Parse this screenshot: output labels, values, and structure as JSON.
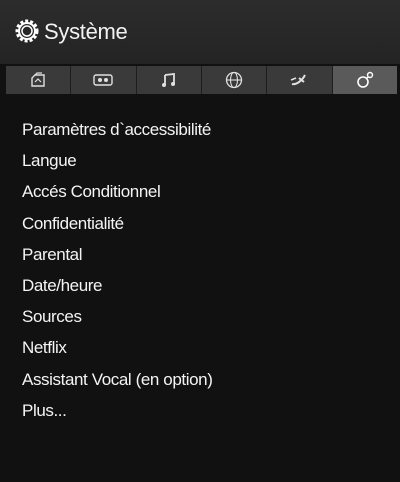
{
  "header": {
    "title": "Système",
    "icon": "gear-ring-icon"
  },
  "tabs": [
    {
      "icon": "picture-icon",
      "active": false
    },
    {
      "icon": "video-tape-icon",
      "active": false
    },
    {
      "icon": "music-note-icon",
      "active": false
    },
    {
      "icon": "network-globe-icon",
      "active": false
    },
    {
      "icon": "satellite-icon",
      "active": false
    },
    {
      "icon": "system-settings-icon",
      "active": true
    }
  ],
  "menu": {
    "items": [
      {
        "label": "Paramètres d`accessibilité"
      },
      {
        "label": "Langue"
      },
      {
        "label": "Accés Conditionnel"
      },
      {
        "label": "Confidentialité"
      },
      {
        "label": "Parental"
      },
      {
        "label": "Date/heure"
      },
      {
        "label": "Sources"
      },
      {
        "label": "Netflix"
      },
      {
        "label": "Assistant Vocal (en option)"
      },
      {
        "label": "Plus..."
      }
    ]
  },
  "colors": {
    "background": "#111111",
    "header": "#262626",
    "tabbar": "#3a3a3a",
    "tab_active": "#5a5a5a",
    "text": "#f4f4f4"
  }
}
